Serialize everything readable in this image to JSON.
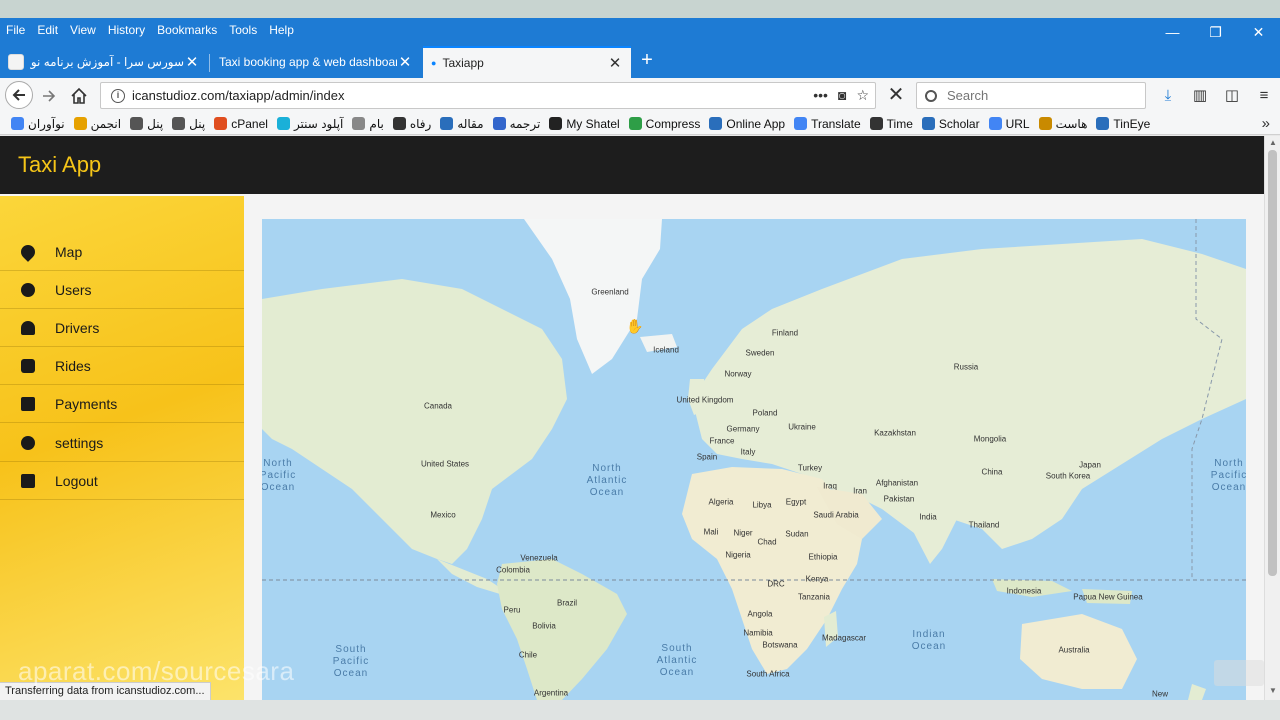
{
  "menu": [
    "File",
    "Edit",
    "View",
    "History",
    "Bookmarks",
    "Tools",
    "Help"
  ],
  "tabs": [
    {
      "title": "سورس سرا - آموزش برنامه نویسی"
    },
    {
      "title": "Taxi booking app & web dashboard"
    },
    {
      "title": "Taxiapp"
    }
  ],
  "url": "icanstudioz.com/taxiapp/admin/index",
  "search_placeholder": "Search",
  "bookmarks": [
    {
      "label": "نوآوران",
      "color": "#4285f4"
    },
    {
      "label": "انجمن",
      "color": "#e6a100"
    },
    {
      "label": "پنل",
      "color": "#555555"
    },
    {
      "label": "پنل",
      "color": "#555555"
    },
    {
      "label": "cPanel",
      "color": "#e04e1f"
    },
    {
      "label": "آپلود سنتر",
      "color": "#1ab0d8"
    },
    {
      "label": "بام",
      "color": "#888888"
    },
    {
      "label": "رفاه",
      "color": "#333333"
    },
    {
      "label": "مقاله",
      "color": "#2a6ebb"
    },
    {
      "label": "ترجمه",
      "color": "#3366cc"
    },
    {
      "label": "My Shatel",
      "color": "#222222"
    },
    {
      "label": "Compress",
      "color": "#2e9e47"
    },
    {
      "label": "Online App",
      "color": "#2a6ebb"
    },
    {
      "label": "Translate",
      "color": "#4285f4"
    },
    {
      "label": "Time",
      "color": "#333333"
    },
    {
      "label": "Scholar",
      "color": "#2a6ebb"
    },
    {
      "label": "URL",
      "color": "#4285f4"
    },
    {
      "label": "هاست",
      "color": "#c98a00"
    },
    {
      "label": "TinEye",
      "color": "#2a6ebb"
    }
  ],
  "app": {
    "title": "Taxi App"
  },
  "sidebar": [
    {
      "label": "Map",
      "icon": "map-marker-icon"
    },
    {
      "label": "Users",
      "icon": "users-icon"
    },
    {
      "label": "Drivers",
      "icon": "driver-icon"
    },
    {
      "label": "Rides",
      "icon": "car-icon"
    },
    {
      "label": "Payments",
      "icon": "wallet-icon"
    },
    {
      "label": "settings",
      "icon": "gears-icon"
    },
    {
      "label": "Logout",
      "icon": "logout-icon"
    }
  ],
  "map": {
    "countries": [
      "Greenland",
      "Iceland",
      "Finland",
      "Sweden",
      "Norway",
      "Russia",
      "United Kingdom",
      "Poland",
      "Germany",
      "Ukraine",
      "France",
      "Kazakhstan",
      "Mongolia",
      "Italy",
      "Spain",
      "Canada",
      "United States",
      "Turkey",
      "China",
      "Japan",
      "South Korea",
      "Afghanistan",
      "Iraq",
      "Iran",
      "Pakistan",
      "Mexico",
      "Algeria",
      "Libya",
      "Egypt",
      "Saudi Arabia",
      "India",
      "Thailand",
      "Mali",
      "Niger",
      "Chad",
      "Sudan",
      "Nigeria",
      "Ethiopia",
      "Venezuela",
      "Colombia",
      "Kenya",
      "DRC",
      "Tanzania",
      "Indonesia",
      "Papua New Guinea",
      "Peru",
      "Brazil",
      "Angola",
      "Bolivia",
      "Namibia",
      "Madagascar",
      "Botswana",
      "Chile",
      "South Africa",
      "Australia",
      "Argentina",
      "New"
    ],
    "oceans": [
      "North Pacific Ocean",
      "North Atlantic Ocean",
      "North Pacific Ocean",
      "South Pacific Ocean",
      "South Atlantic Ocean",
      "Indian Ocean"
    ],
    "ocean_color": "#a8d4f2",
    "land_color": "#e8efd6"
  },
  "status": "Transferring data from icanstudioz.com...",
  "watermark": "aparat.com/sourcesara"
}
